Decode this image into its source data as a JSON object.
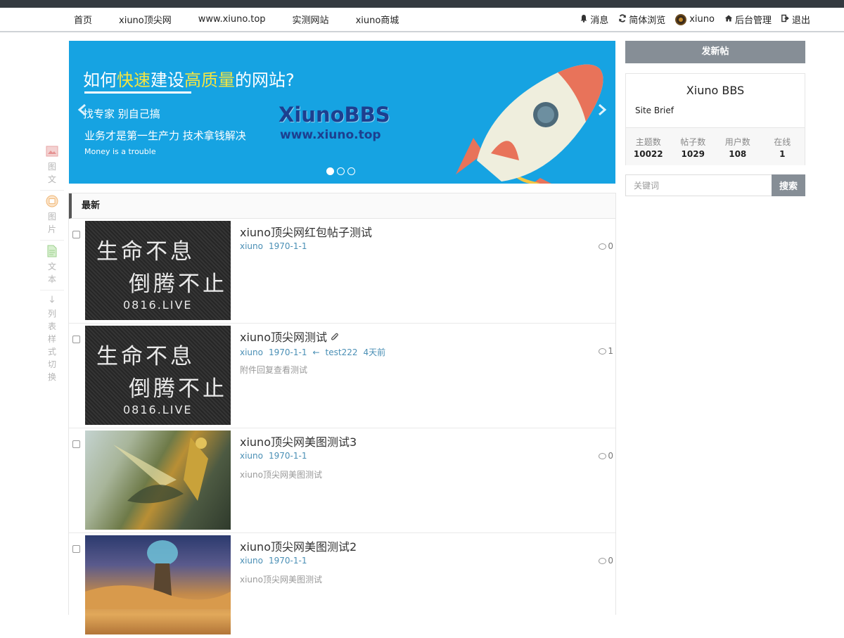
{
  "nav": {
    "left": [
      "首页",
      "xiuno顶尖网",
      "www.xiuno.top",
      "实测网站",
      "xiuno商城"
    ],
    "messages": "消息",
    "lang": "简体浏览",
    "user": "xiuno",
    "admin": "后台管理",
    "logout": "退出"
  },
  "sidebar": {
    "items": [
      "图文",
      "图片",
      "文本",
      "列表样式切换"
    ]
  },
  "banner": {
    "heading_pre": "如何",
    "heading_hl1": "快速",
    "heading_mid": "建设",
    "heading_hl2": "高质量",
    "heading_post": "的网站?",
    "line1": "找专家 别自己搞",
    "line2": "业务才是第一生产力 技术拿钱解决",
    "line3": "Money is a trouble",
    "brand": "XiunoBBS",
    "url": "www.xiuno.top",
    "slide_count": 3,
    "active_slide": 0
  },
  "list": {
    "header": "最新",
    "threads": [
      {
        "title": "xiuno顶尖网红包帖子测试",
        "author": "xiuno",
        "date": "1970-1-1",
        "last_reply_user": "",
        "last_reply_time": "",
        "brief": "",
        "replies": "0",
        "thumb": "calligraphy",
        "attachment": false
      },
      {
        "title": "xiuno顶尖网测试",
        "author": "xiuno",
        "date": "1970-1-1",
        "last_reply_user": "test222",
        "last_reply_time": "4天前",
        "brief": "附件回复查看测试",
        "replies": "1",
        "thumb": "calligraphy",
        "attachment": true
      },
      {
        "title": "xiuno顶尖网美图测试3",
        "author": "xiuno",
        "date": "1970-1-1",
        "last_reply_user": "",
        "last_reply_time": "",
        "brief": "xiuno顶尖网美图测试",
        "replies": "0",
        "thumb": "art1",
        "attachment": false
      },
      {
        "title": "xiuno顶尖网美图测试2",
        "author": "xiuno",
        "date": "1970-1-1",
        "last_reply_user": "",
        "last_reply_time": "",
        "brief": "xiuno顶尖网美图测试",
        "replies": "0",
        "thumb": "art2",
        "attachment": false
      }
    ],
    "calligraphy": {
      "line1": "生命不息",
      "line2": "倒腾不止",
      "line3": "0816.LIVE"
    }
  },
  "right": {
    "new_post": "发新帖",
    "site_name": "Xiuno BBS",
    "site_brief": "Site Brief",
    "stats": [
      {
        "label": "主题数",
        "value": "10022"
      },
      {
        "label": "帖子数",
        "value": "1029"
      },
      {
        "label": "用户数",
        "value": "108"
      },
      {
        "label": "在线",
        "value": "1"
      }
    ],
    "search_placeholder": "关键词",
    "search_button": "搜索"
  },
  "colors": {
    "banner_bg": "#16a3e2",
    "accent_gray": "#868e96",
    "link": "#4a8fb5",
    "topbar": "#343a40"
  }
}
